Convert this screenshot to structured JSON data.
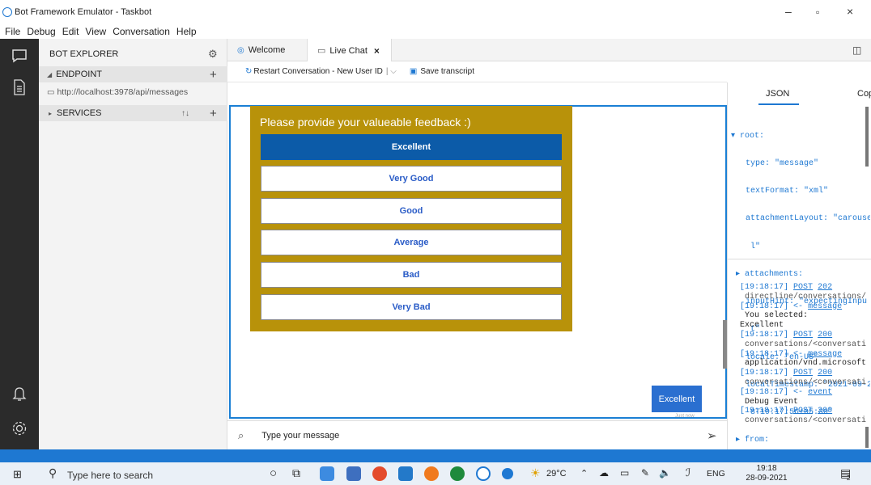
{
  "window": {
    "title": "Bot Framework Emulator - Taskbot"
  },
  "menu": [
    "File",
    "Debug",
    "Edit",
    "View",
    "Conversation",
    "Help"
  ],
  "explorer": {
    "title": "BOT EXPLORER",
    "endpoint_label": "ENDPOINT",
    "endpoint_url": "http://localhost:3978/api/messages",
    "services_label": "SERVICES"
  },
  "tabs": [
    {
      "label": "Welcome"
    },
    {
      "label": "Live Chat"
    }
  ],
  "toolbar": {
    "restart": "Restart Conversation - New User ID",
    "save": "Save transcript"
  },
  "card": {
    "title": "Please provide your valueable feedback :)",
    "options": [
      "Excellent",
      "Very Good",
      "Good",
      "Average",
      "Bad",
      "Very Bad"
    ],
    "selected_index": 0
  },
  "user_message": {
    "text": "Excellent",
    "status": "Just now"
  },
  "input": {
    "placeholder": "Type your message"
  },
  "inspector": {
    "tabs": [
      "JSON",
      "Cop"
    ],
    "json_lines": [
      "▾ root:",
      "   type: \"message\"",
      "   textFormat: \"xml\"",
      "   attachmentLayout: \"carouse",
      "    l\"",
      " ▸ attachments:",
      "   inputHint: \"expectingInpu",
      "    t\"",
      "   locale: \"en-US\"",
      "   localTimestamp: \"2021-09-2",
      "    8T19:17:56+05:30\"",
      " ▸ from:"
    ]
  },
  "log": [
    {
      "time": "[19:18:17]",
      "link": "POST",
      "code": "202",
      "detail": "directline/conversations/"
    },
    {
      "time": "[19:18:17]",
      "arrow": "<-",
      "link": "message",
      "detail": "You selected:"
    },
    {
      "text": "Excellent"
    },
    {
      "time": "[19:18:17]",
      "link": "POST",
      "code": "200",
      "detail": "conversations/<conversati"
    },
    {
      "time": "[19:18:17]",
      "arrow": "<-",
      "link": "message",
      "detail": "application/vnd.microsoft"
    },
    {
      "time": "[19:18:17]",
      "link": "POST",
      "code": "200",
      "detail": "conversations/<conversati"
    },
    {
      "time": "[19:18:17]",
      "arrow": "<-",
      "link": "event",
      "detail": "Debug Event"
    },
    {
      "time": "[19:18:17]",
      "link": "POST",
      "code": "200",
      "detail": "conversations/<conversati"
    }
  ],
  "taskbar": {
    "search_placeholder": "Type here to search",
    "weather": "29°C",
    "lang": "ENG",
    "time": "19:18",
    "date": "28-09-2021",
    "notif_count": "2"
  },
  "colors": {
    "accent": "#1e78d2",
    "card": "#b8920a",
    "selected": "#0c5ba8",
    "activity": "#2b2b2b"
  }
}
